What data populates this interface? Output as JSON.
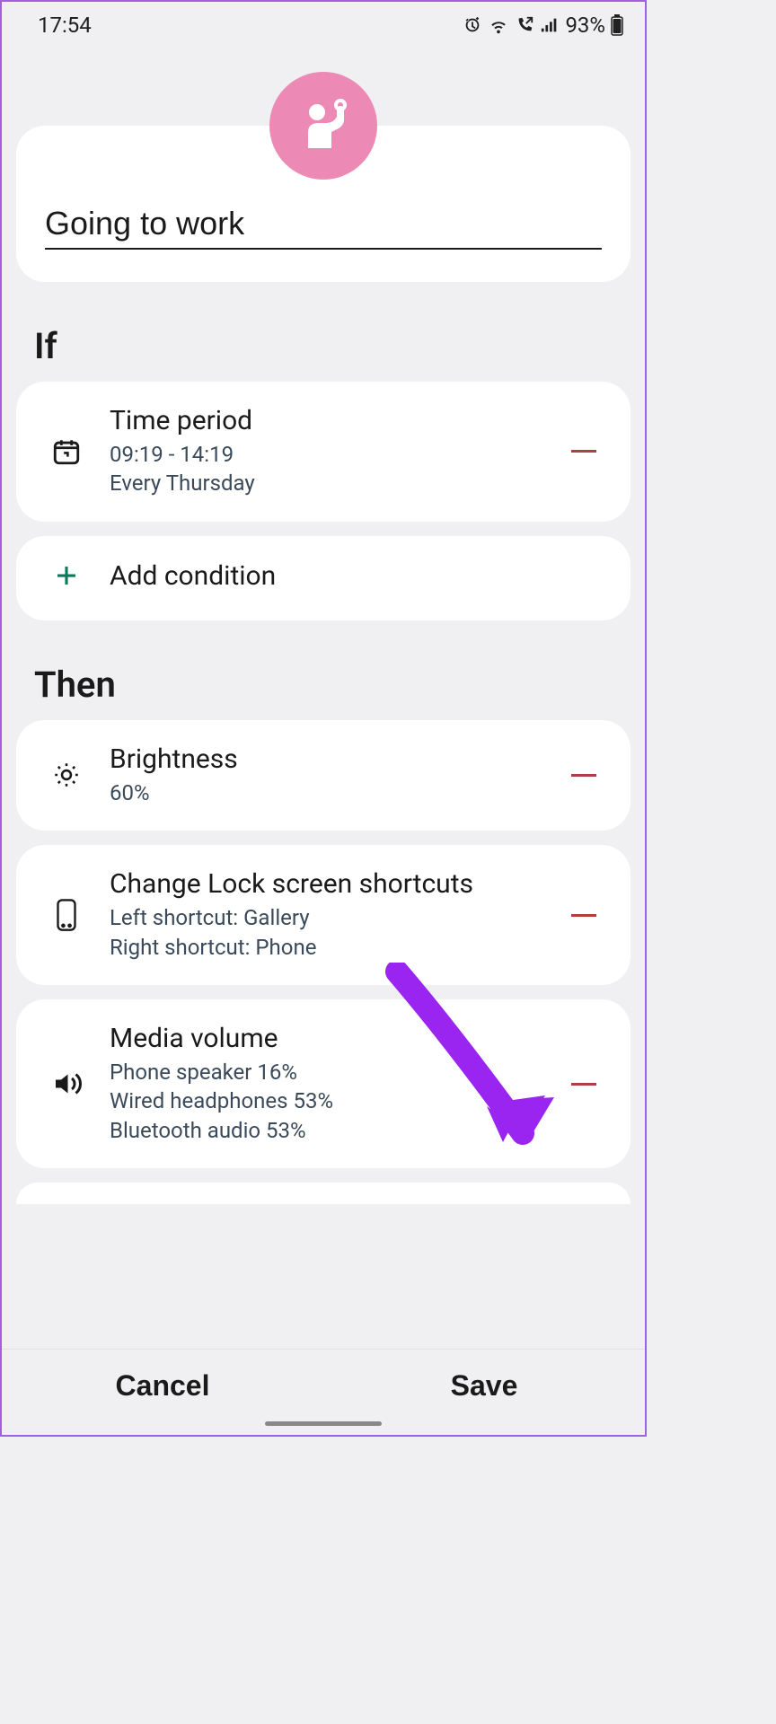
{
  "status": {
    "time": "17:54",
    "battery_pct": "93%"
  },
  "colors": {
    "avatar_bg": "#ec8ab5",
    "accent_green": "#0a7a5a",
    "remove_red": "#b04040",
    "arrow": "#9a24f0"
  },
  "routine": {
    "name": "Going to work"
  },
  "sections": {
    "if_label": "If",
    "then_label": "Then"
  },
  "if_items": [
    {
      "icon": "calendar-clock-icon",
      "title": "Time period",
      "sub1": "09:19 - 14:19",
      "sub2": "Every Thursday"
    }
  ],
  "add_condition_label": "Add condition",
  "then_items": [
    {
      "icon": "brightness-icon",
      "title": "Brightness",
      "sub1": "60%"
    },
    {
      "icon": "phone-frame-icon",
      "title": "Change Lock screen shortcuts",
      "sub1": "Left shortcut: Gallery",
      "sub2": "Right shortcut: Phone"
    },
    {
      "icon": "speaker-icon",
      "title": "Media volume",
      "sub1": "Phone speaker 16%",
      "sub2": "Wired headphones 53%",
      "sub3": "Bluetooth audio 53%"
    }
  ],
  "buttons": {
    "cancel": "Cancel",
    "save": "Save"
  }
}
